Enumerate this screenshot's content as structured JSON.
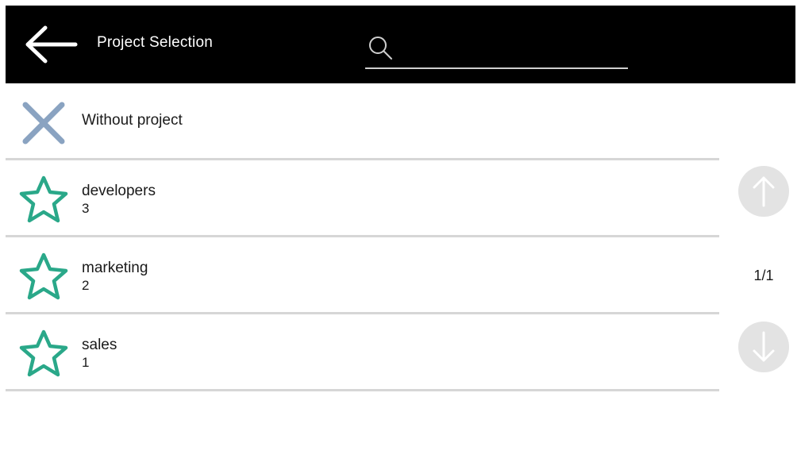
{
  "header": {
    "title": "Project Selection",
    "back_icon": "arrow-left-icon",
    "search": {
      "icon": "search-icon",
      "value": "",
      "placeholder": ""
    }
  },
  "list": {
    "no_project": {
      "label": "Without project",
      "icon": "close-icon",
      "icon_color": "#8aa3c1"
    },
    "projects": [
      {
        "name": "developers",
        "count": "3",
        "icon": "star-icon"
      },
      {
        "name": "marketing",
        "count": "2",
        "icon": "star-icon"
      },
      {
        "name": "sales",
        "count": "1",
        "icon": "star-icon"
      }
    ],
    "star_color": "#2aa889"
  },
  "pagination": {
    "page": "1/1",
    "up_icon": "arrow-up-icon",
    "down_icon": "arrow-down-icon",
    "button_color": "#e3e3e3"
  }
}
